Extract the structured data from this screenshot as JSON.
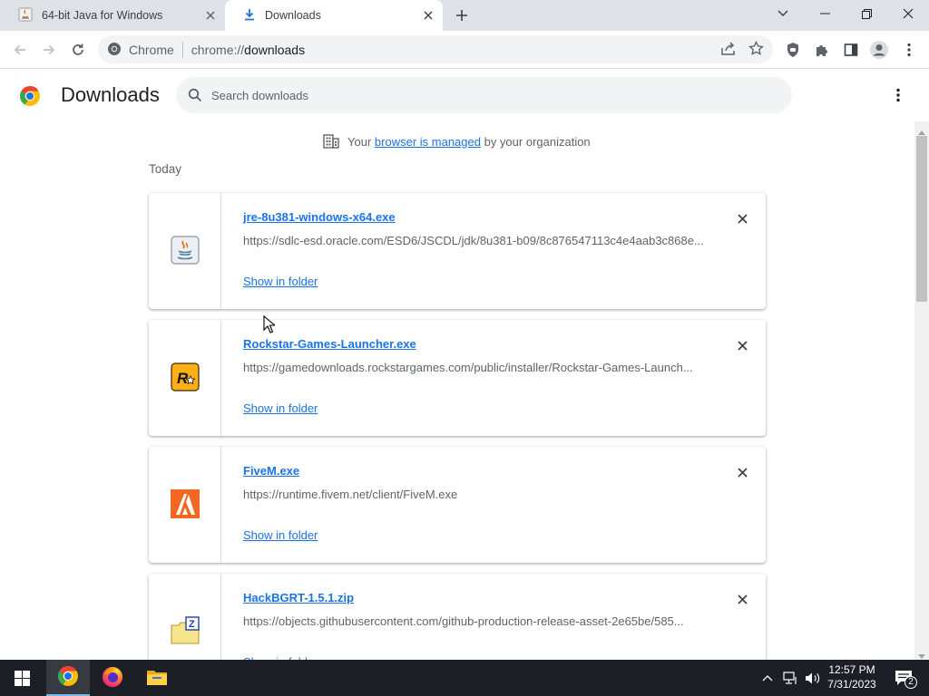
{
  "tabs": [
    {
      "title": "64-bit Java for Windows",
      "active": false
    },
    {
      "title": "Downloads",
      "active": true
    }
  ],
  "toolbar": {
    "omnibox_label": "Chrome",
    "url_prefix": "chrome://",
    "url_path": "downloads"
  },
  "page": {
    "title": "Downloads",
    "search_placeholder": "Search downloads",
    "managed_prefix": "Your",
    "managed_link": "browser is managed",
    "managed_suffix": "by your organization",
    "section_label": "Today"
  },
  "downloads": [
    {
      "filename": "jre-8u381-windows-x64.exe",
      "url": "https://sdlc-esd.oracle.com/ESD6/JSCDL/jdk/8u381-b09/8c876547113c4e4aab3c868e...",
      "action": "Show in folder",
      "icon": "java-icon"
    },
    {
      "filename": "Rockstar-Games-Launcher.exe",
      "url": "https://gamedownloads.rockstargames.com/public/installer/Rockstar-Games-Launch...",
      "action": "Show in folder",
      "icon": "rockstar-icon"
    },
    {
      "filename": "FiveM.exe",
      "url": "https://runtime.fivem.net/client/FiveM.exe",
      "action": "Show in folder",
      "icon": "fivem-icon"
    },
    {
      "filename": "HackBGRT-1.5.1.zip",
      "url": "https://objects.githubusercontent.com/github-production-release-asset-2e65be/585...",
      "action": "Show in folder",
      "icon": "zip-archive-icon"
    }
  ],
  "taskbar": {
    "time": "12:57 PM",
    "date": "7/31/2023",
    "notification_count": "2"
  },
  "colors": {
    "accent": "#1a73e8",
    "tabstrip": "#dee1e6",
    "taskbar": "#1c1f26"
  }
}
